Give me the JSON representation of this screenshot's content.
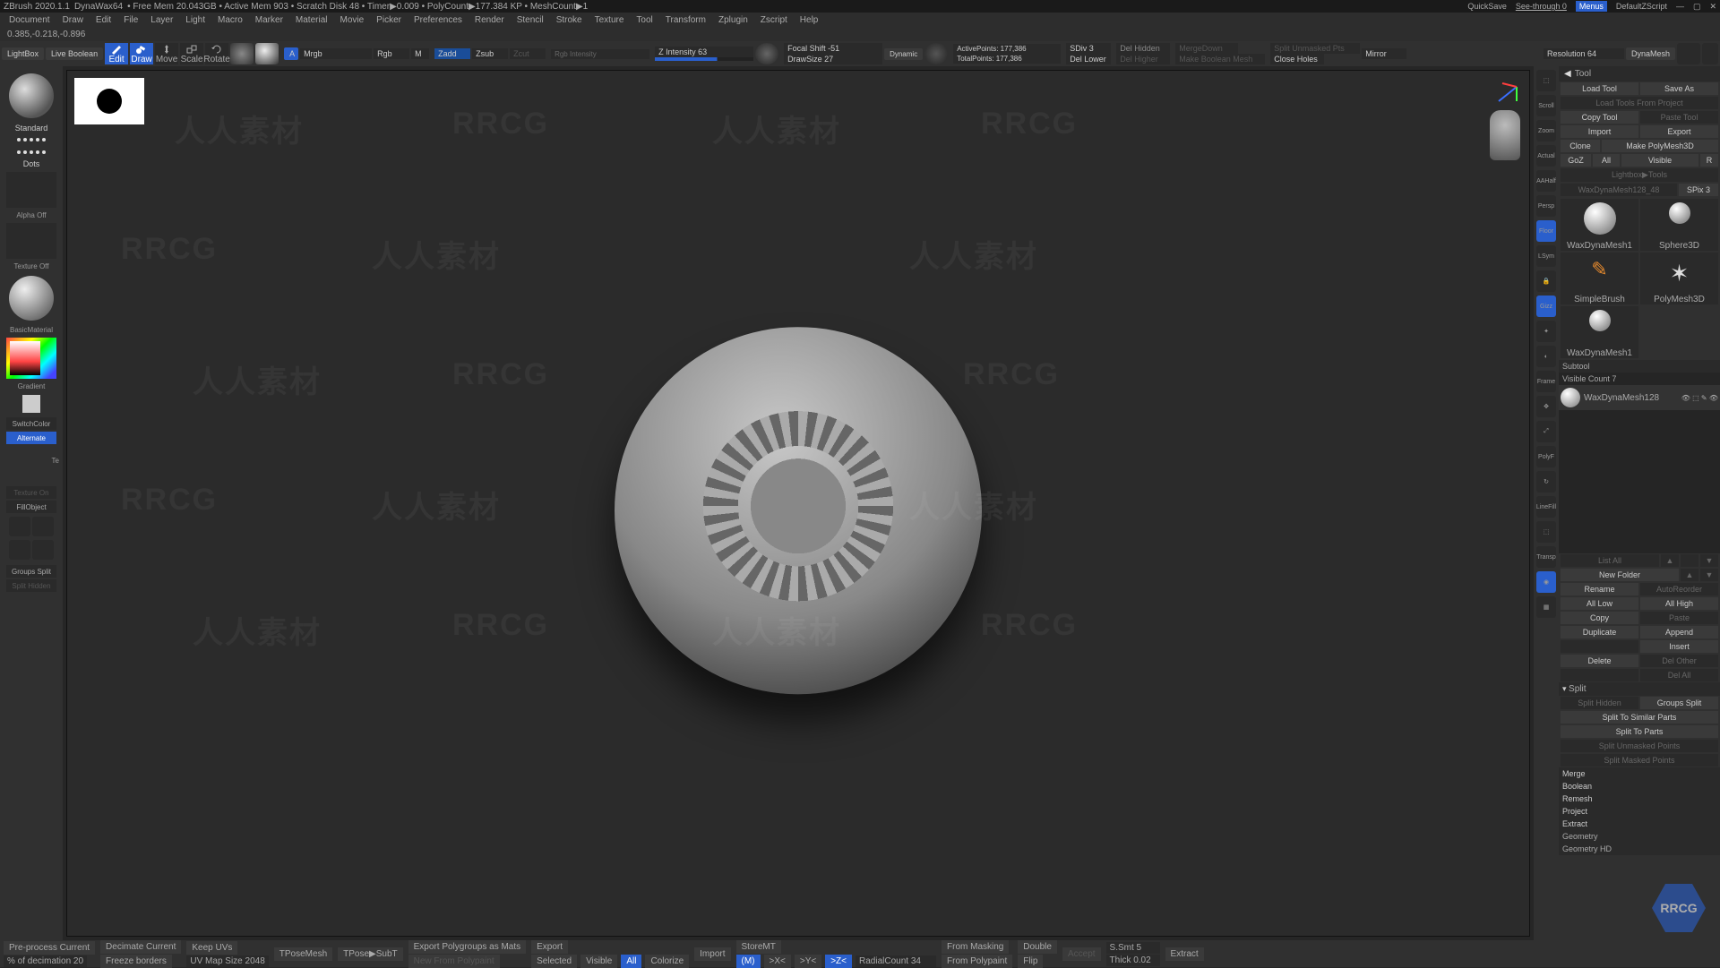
{
  "titlebar": {
    "app": "ZBrush 2020.1.1",
    "doc": "DynaWax64",
    "stats": "• Free Mem 20.043GB • Active Mem 903 • Scratch Disk 48 • Timer▶0.009 • PolyCount▶177.384 KP • MeshCount▶1",
    "quicksave": "QuickSave",
    "seethru": "See-through  0",
    "menus": "Menus",
    "defscript": "DefaultZScript"
  },
  "menu": [
    "",
    "",
    "",
    "Document",
    "Draw",
    "Edit",
    "File",
    "Layer",
    "Light",
    "Macro",
    "Marker",
    "Material",
    "Movie",
    "Picker",
    "Preferences",
    "Render",
    "Stencil",
    "Stroke",
    "Texture",
    "Tool",
    "Transform",
    "Zplugin",
    "Zscript",
    "Help"
  ],
  "coords": "0.385,-0.218,-0.896",
  "toolbar": {
    "lightbox": "LightBox",
    "liveboolean": "Live Boolean",
    "modes": {
      "edit": "Edit",
      "draw": "Draw",
      "move": "Move",
      "scale": "Scale",
      "rotate": "Rotate"
    },
    "mrgb_label": "Mrgb",
    "rgb_label": "Rgb",
    "m_label": "M",
    "rgb_intensity": "Rgb Intensity",
    "zadd": "Zadd",
    "zsub": "Zsub",
    "zcut": "Zcut",
    "zintensity": "Z Intensity 63",
    "focal": "Focal Shift -51",
    "drawsize": "DrawSize 27",
    "dynamic": "Dynamic",
    "active": "ActivePoints: 177,386",
    "sdiv": "SDiv 3",
    "total": "TotalPoints: 177,386",
    "dellower": "Del Lower",
    "delhidden": "Del Hidden",
    "delhigher": "Del Higher",
    "mergedown": "MergeDown",
    "makeboolean": "Make Boolean Mesh",
    "splitunmasked": "Split Unmasked Pts",
    "closeholes": "Close Holes",
    "mirror": "Mirror",
    "resolution": "Resolution 64",
    "dynamesh": "DynaMesh"
  },
  "left": {
    "brush": "Standard",
    "stroke": "Dots",
    "alpha": "Alpha Off",
    "texture": "Texture Off",
    "material": "BasicMaterial",
    "gradient": "Gradient",
    "switchcolor": "SwitchColor",
    "alternate": "Alternate",
    "te": "Te",
    "textureon": "Texture On",
    "fillobject": "FillObject",
    "groupssplit": "Groups Split",
    "splithidden": "Split Hidden"
  },
  "rightstrip": [
    "",
    "Scroll",
    "Zoom",
    "Actual",
    "AAHalf",
    "Persp",
    "Floor",
    "LSym",
    "",
    "Gizz",
    "",
    "",
    "Frame",
    "",
    "",
    "PolyF",
    "",
    "LineFill",
    "",
    "Transp",
    "",
    ""
  ],
  "tool": {
    "header": "Tool",
    "loadtool": "Load Tool",
    "saveas": "Save As",
    "loadproject": "Load Tools From Project",
    "copytool": "Copy Tool",
    "pastetool": "Paste Tool",
    "import": "Import",
    "export": "Export",
    "clone": "Clone",
    "makepoly": "Make PolyMesh3D",
    "goz": "GoZ",
    "all": "All",
    "visible": "Visible",
    "r": "R",
    "lightboxtools": "Lightbox▶Tools",
    "current": "WaxDynaMesh128_48",
    "spix": "SPix 3",
    "thumbs": [
      "WaxDynaMesh1",
      "Sphere3D",
      "SimpleBrush",
      "PolyMesh3D",
      "WaxDynaMesh1"
    ],
    "subtool": "Subtool",
    "visiblecount": "Visible Count 7",
    "subtool_name": "WaxDynaMesh128",
    "listall": "List All",
    "newfolder": "New Folder",
    "rename": "Rename",
    "autoreorder": "AutoReorder",
    "alllow": "All Low",
    "allhigh": "All High",
    "copy": "Copy",
    "paste": "Paste",
    "duplicate": "Duplicate",
    "append": "Append",
    "insert": "Insert",
    "delete": "Delete",
    "delother": "Del Other",
    "delall": "Del All",
    "split": "Split",
    "splithidden": "Split Hidden",
    "groupssplit": "Groups Split",
    "splitsimilar": "Split To Similar Parts",
    "splitparts": "Split To Parts",
    "splitunmasked": "Split Unmasked Points",
    "splitmasked": "Split Masked Points",
    "merge": "Merge",
    "boolean": "Boolean",
    "remesh": "Remesh",
    "project": "Project",
    "extract": "Extract",
    "geometry": "Geometry",
    "geometryhd": "Geometry HD"
  },
  "bottom": {
    "preprocess": "Pre-process Current",
    "pctdecim": "% of decimation 20",
    "deccurrent": "Decimate Current",
    "freeze": "Freeze borders",
    "keepuv": "Keep UVs",
    "uvmap": "UV Map Size 2048",
    "tposemesh": "TPoseMesh",
    "tposesubt": "TPose▶SubT",
    "exportpoly": "Export Polygroups as Mats",
    "newpolypaint": "New From Polypaint",
    "export": "Export",
    "selected": "Selected",
    "visible": "Visible",
    "all": "All",
    "colorize": "Colorize",
    "import": "Import",
    "storemt": "StoreMT",
    "mt": "(M)",
    "mx": ">X<",
    "my": ">Y<",
    "mz": ">Z<",
    "frommask": "From Masking",
    "radcount": "RadialCount 34",
    "frompolypaint": "From Polypaint",
    "double": "Double",
    "flip": "Flip",
    "accept": "Accept",
    "ssmt": "S.Smt 5",
    "thick": "Thick 0.02",
    "extract": "Extract"
  }
}
